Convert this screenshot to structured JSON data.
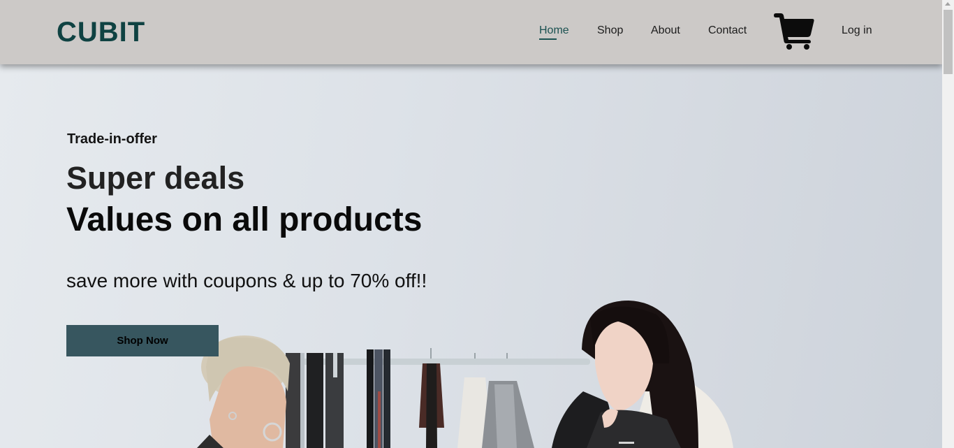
{
  "brand": {
    "logo_text": "CUBIT",
    "color": "#0f4242"
  },
  "nav": {
    "items": [
      {
        "label": "Home",
        "active": true
      },
      {
        "label": "Shop",
        "active": false
      },
      {
        "label": "About",
        "active": false
      },
      {
        "label": "Contact",
        "active": false
      }
    ],
    "cart_icon": "shopping-cart-icon",
    "login_label": "Log in"
  },
  "hero": {
    "tagline": "Trade-in-offer",
    "headline_1": "Super deals",
    "headline_2": "Values on all products",
    "subtitle": "save more with coupons & up to 70% off!!",
    "cta_label": "Shop Now",
    "cta_color": "#37565f"
  },
  "colors": {
    "header_bg": "#ccc9c7",
    "accent": "#1b5151"
  }
}
